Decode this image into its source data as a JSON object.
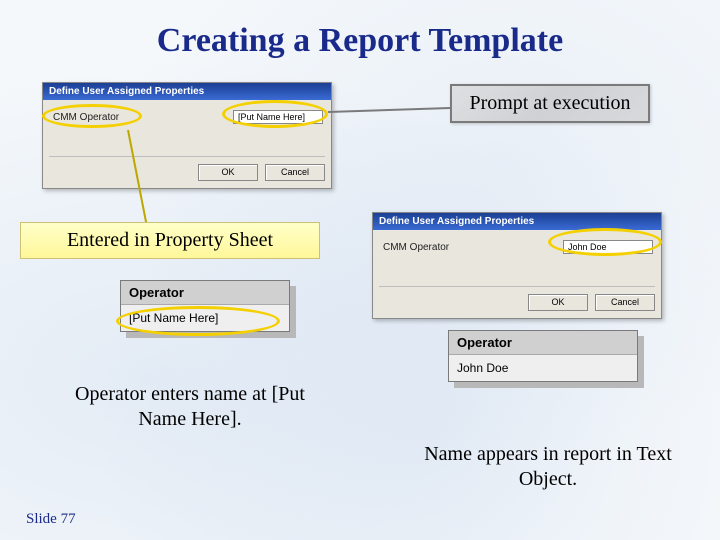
{
  "title": "Creating a Report Template",
  "slide_number": "Slide 77",
  "callouts": {
    "prompt": "Prompt at execution",
    "entered": "Entered in Property Sheet",
    "operator_enters": "Operator enters name at [Put Name Here].",
    "name_appears": "Name appears in report in Text Object."
  },
  "dialog1": {
    "title": "Define User Assigned Properties",
    "field_label": "CMM Operator",
    "field_value": "[Put Name Here]",
    "ok": "OK",
    "cancel": "Cancel"
  },
  "dialog2": {
    "title": "Define User Assigned Properties",
    "field_label": "CMM Operator",
    "field_value": "John Doe",
    "ok": "OK",
    "cancel": "Cancel"
  },
  "textobj1": {
    "header": "Operator",
    "value": "[Put Name Here]"
  },
  "textobj2": {
    "header": "Operator",
    "value": "John Doe"
  }
}
